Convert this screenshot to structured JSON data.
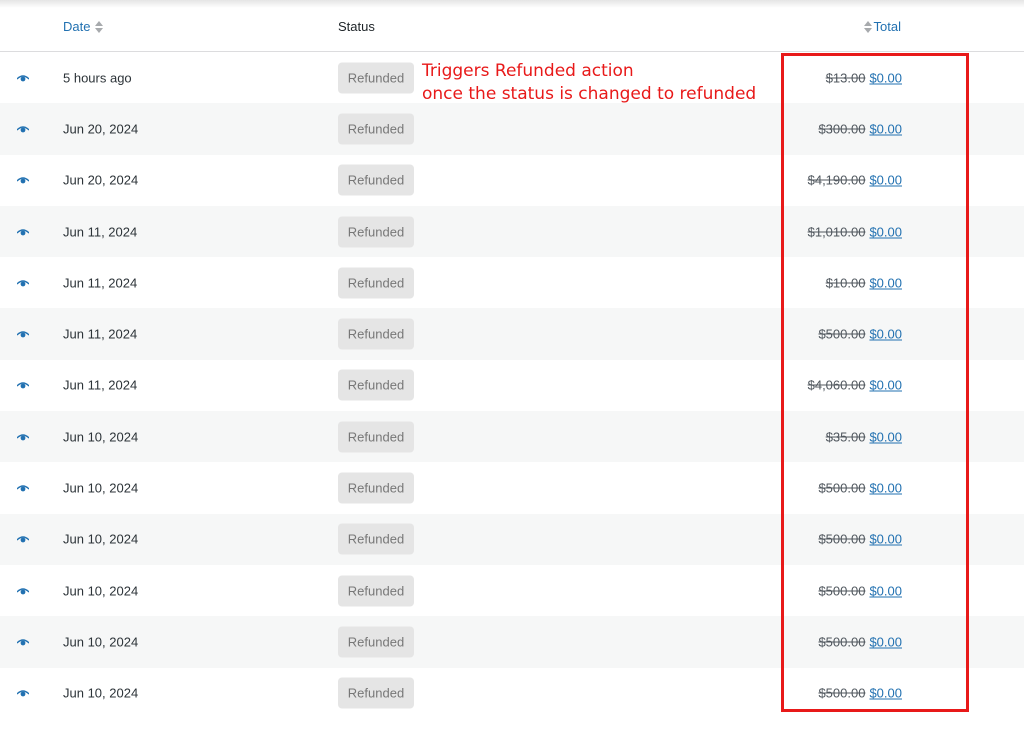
{
  "header": {
    "date_label": "Date",
    "status_label": "Status",
    "total_label": "Total"
  },
  "annotation": {
    "line1": "Triggers Refunded action",
    "line2": "once the status is changed to refunded"
  },
  "colors": {
    "link": "#2271b1",
    "annotation": "#e81919",
    "badge_bg": "#e5e5e5"
  },
  "orders": [
    {
      "date": "5 hours ago",
      "status": "Refunded",
      "old_total": "$13.00",
      "new_total": "$0.00"
    },
    {
      "date": "Jun 20, 2024",
      "status": "Refunded",
      "old_total": "$300.00",
      "new_total": "$0.00"
    },
    {
      "date": "Jun 20, 2024",
      "status": "Refunded",
      "old_total": "$4,190.00",
      "new_total": "$0.00"
    },
    {
      "date": "Jun 11, 2024",
      "status": "Refunded",
      "old_total": "$1,010.00",
      "new_total": "$0.00"
    },
    {
      "date": "Jun 11, 2024",
      "status": "Refunded",
      "old_total": "$10.00",
      "new_total": "$0.00"
    },
    {
      "date": "Jun 11, 2024",
      "status": "Refunded",
      "old_total": "$500.00",
      "new_total": "$0.00"
    },
    {
      "date": "Jun 11, 2024",
      "status": "Refunded",
      "old_total": "$4,060.00",
      "new_total": "$0.00"
    },
    {
      "date": "Jun 10, 2024",
      "status": "Refunded",
      "old_total": "$35.00",
      "new_total": "$0.00"
    },
    {
      "date": "Jun 10, 2024",
      "status": "Refunded",
      "old_total": "$500.00",
      "new_total": "$0.00"
    },
    {
      "date": "Jun 10, 2024",
      "status": "Refunded",
      "old_total": "$500.00",
      "new_total": "$0.00"
    },
    {
      "date": "Jun 10, 2024",
      "status": "Refunded",
      "old_total": "$500.00",
      "new_total": "$0.00"
    },
    {
      "date": "Jun 10, 2024",
      "status": "Refunded",
      "old_total": "$500.00",
      "new_total": "$0.00"
    },
    {
      "date": "Jun 10, 2024",
      "status": "Refunded",
      "old_total": "$500.00",
      "new_total": "$0.00"
    }
  ]
}
